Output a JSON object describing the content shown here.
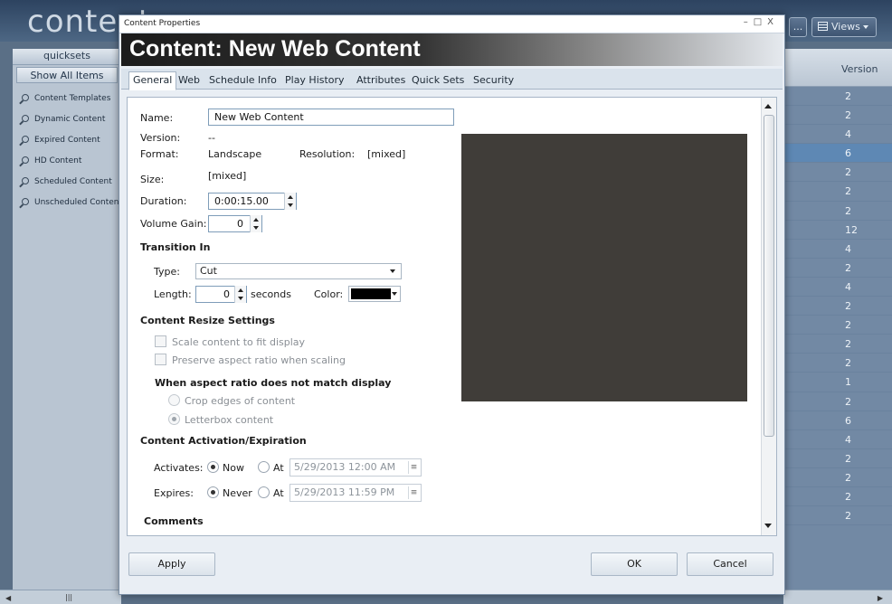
{
  "app": {
    "title": "content",
    "header_buttons": {
      "more_label": "...",
      "views_label": "Views"
    }
  },
  "quicksets": {
    "title": "quicksets",
    "show_all_label": "Show All Items",
    "items": [
      {
        "label": "Content Templates"
      },
      {
        "label": "Dynamic Content"
      },
      {
        "label": "Expired Content"
      },
      {
        "label": "HD Content"
      },
      {
        "label": "Scheduled Content"
      },
      {
        "label": "Unscheduled Content"
      }
    ]
  },
  "versions": {
    "header": "Version",
    "values": [
      "2",
      "2",
      "4",
      "6",
      "2",
      "2",
      "2",
      "12",
      "4",
      "2",
      "4",
      "2",
      "2",
      "2",
      "2",
      "1",
      "2",
      "6",
      "4",
      "2",
      "2",
      "2",
      "2"
    ],
    "highlighted_index": 3
  },
  "dialog": {
    "window_title": "Content Properties",
    "banner": "Content: New Web Content",
    "tabs": [
      "General",
      "Web",
      "Schedule Info",
      "Play History",
      "Attributes",
      "Quick Sets",
      "Security"
    ],
    "active_tab": "General",
    "general": {
      "name_label": "Name:",
      "name_value": "New Web Content",
      "version_label": "Version:",
      "version_value": "--",
      "format_label": "Format:",
      "format_value": "Landscape",
      "resolution_label": "Resolution:",
      "resolution_value": "[mixed]",
      "size_label": "Size:",
      "size_value": "[mixed]",
      "duration_label": "Duration:",
      "duration_value": "0:00:15.00",
      "volume_label": "Volume Gain:",
      "volume_value": "0",
      "transition_heading": "Transition In",
      "type_label": "Type:",
      "type_value": "Cut",
      "length_label": "Length:",
      "length_value": "0",
      "seconds_label": "seconds",
      "color_label": "Color:",
      "preview_color": "#403d39",
      "transition_color": "#000000",
      "resize_heading": "Content Resize Settings",
      "scale_label": "Scale content to fit display",
      "preserve_label": "Preserve aspect ratio when scaling",
      "aspect_heading": "When aspect ratio does not match display",
      "crop_label": "Crop edges of content",
      "letterbox_label": "Letterbox content",
      "activation_heading": "Content Activation/Expiration",
      "activates_label": "Activates:",
      "now_label": "Now",
      "at_label": "At",
      "activates_date": "5/29/2013 12:00 AM",
      "expires_label": "Expires:",
      "never_label": "Never",
      "expires_date": "5/29/2013 11:59 PM",
      "comments_heading": "Comments"
    },
    "buttons": {
      "apply": "Apply",
      "ok": "OK",
      "cancel": "Cancel"
    }
  }
}
